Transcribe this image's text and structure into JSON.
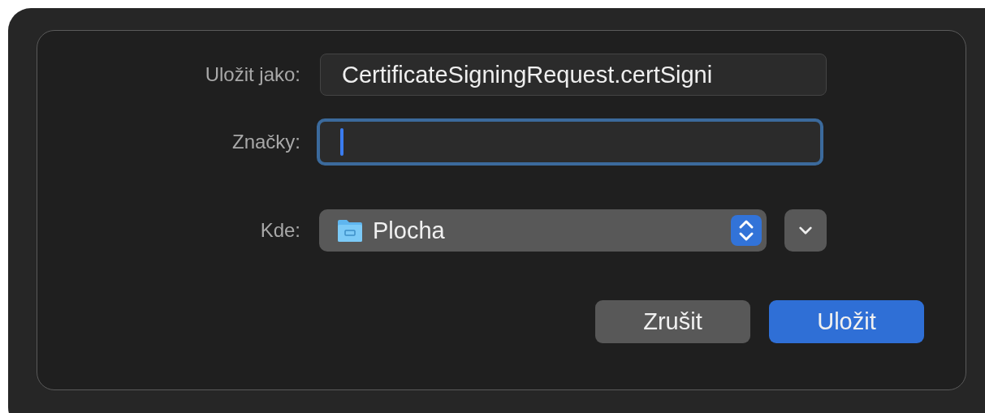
{
  "save_as": {
    "label": "Uložit jako:",
    "value": "CertificateSigningRequest.certSigni"
  },
  "tags": {
    "label": "Značky:",
    "focused": true
  },
  "location": {
    "label": "Kde:",
    "value": "Plocha",
    "expanded": false
  },
  "buttons": [
    {
      "label": "Zrušit",
      "kind": "cancel"
    },
    {
      "label": "Uložit",
      "kind": "default"
    }
  ]
}
